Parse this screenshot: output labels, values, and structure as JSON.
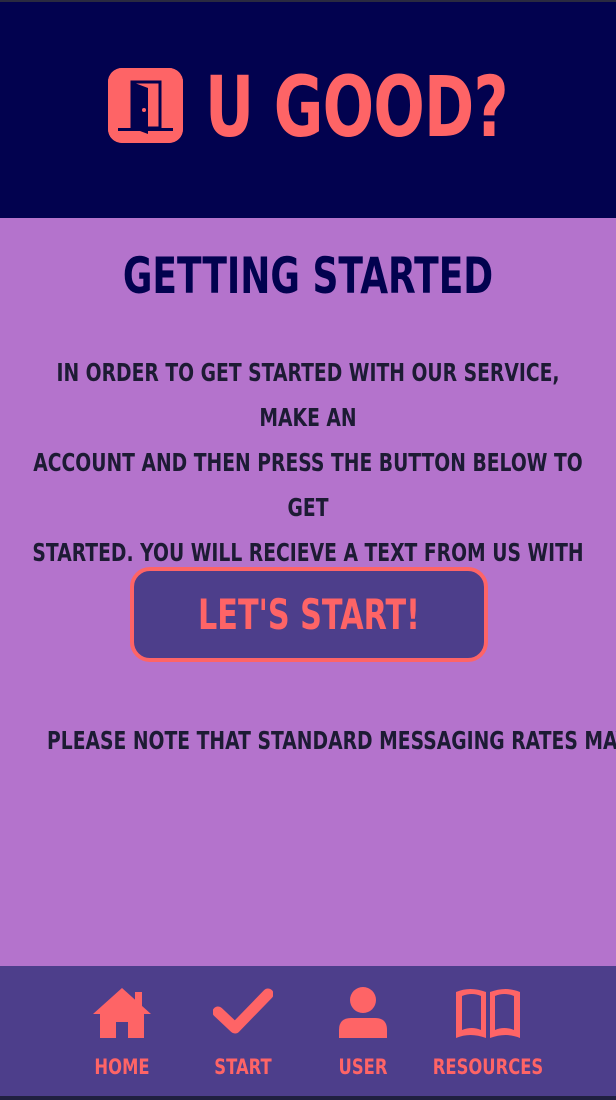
{
  "header": {
    "title": "U GOOD?",
    "logo_icon": "open-door-icon"
  },
  "main": {
    "title": "GETTING STARTED",
    "intro_lines": [
      "IN ORDER TO GET STARTED WITH OUR SERVICE, MAKE AN",
      "ACCOUNT AND THEN PRESS THE BUTTON BELOW TO GET",
      "STARTED. YOU WILL RECIEVE A TEXT FROM US WITH NEXT STEPS."
    ],
    "start_button_label": "LET'S START!",
    "note": "PLEASE NOTE THAT STANDARD MESSAGING RATES MAY APPLY."
  },
  "nav": {
    "items": [
      {
        "label": "HOME",
        "icon": "house-icon"
      },
      {
        "label": "START",
        "icon": "checkmark-icon"
      },
      {
        "label": "USER",
        "icon": "user-icon"
      },
      {
        "label": "RESOURCES",
        "icon": "open-book-icon"
      }
    ]
  },
  "colors": {
    "header_bg": "#02024f",
    "page_bg": "#b473cc",
    "nav_bg": "#4d3e8b",
    "accent": "#fe6466",
    "text_dark": "#1d1b34"
  }
}
